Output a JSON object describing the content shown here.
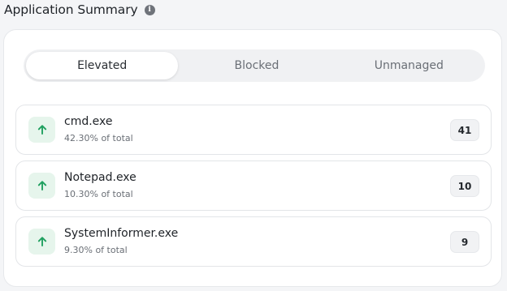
{
  "header": {
    "title": "Application Summary",
    "info_icon": "info-icon"
  },
  "tabs": [
    {
      "label": "Elevated",
      "active": true
    },
    {
      "label": "Blocked",
      "active": false
    },
    {
      "label": "Unmanaged",
      "active": false
    }
  ],
  "items": [
    {
      "name": "cmd.exe",
      "subtitle": "42.30% of total",
      "count": "41",
      "icon": "arrow-up-icon"
    },
    {
      "name": "Notepad.exe",
      "subtitle": "10.30% of total",
      "count": "10",
      "icon": "arrow-up-icon"
    },
    {
      "name": "SystemInformer.exe",
      "subtitle": "9.30% of total",
      "count": "9",
      "icon": "arrow-up-icon"
    }
  ],
  "colors": {
    "accent_green": "#20a060",
    "green_badge_bg": "#e6f5ec"
  }
}
